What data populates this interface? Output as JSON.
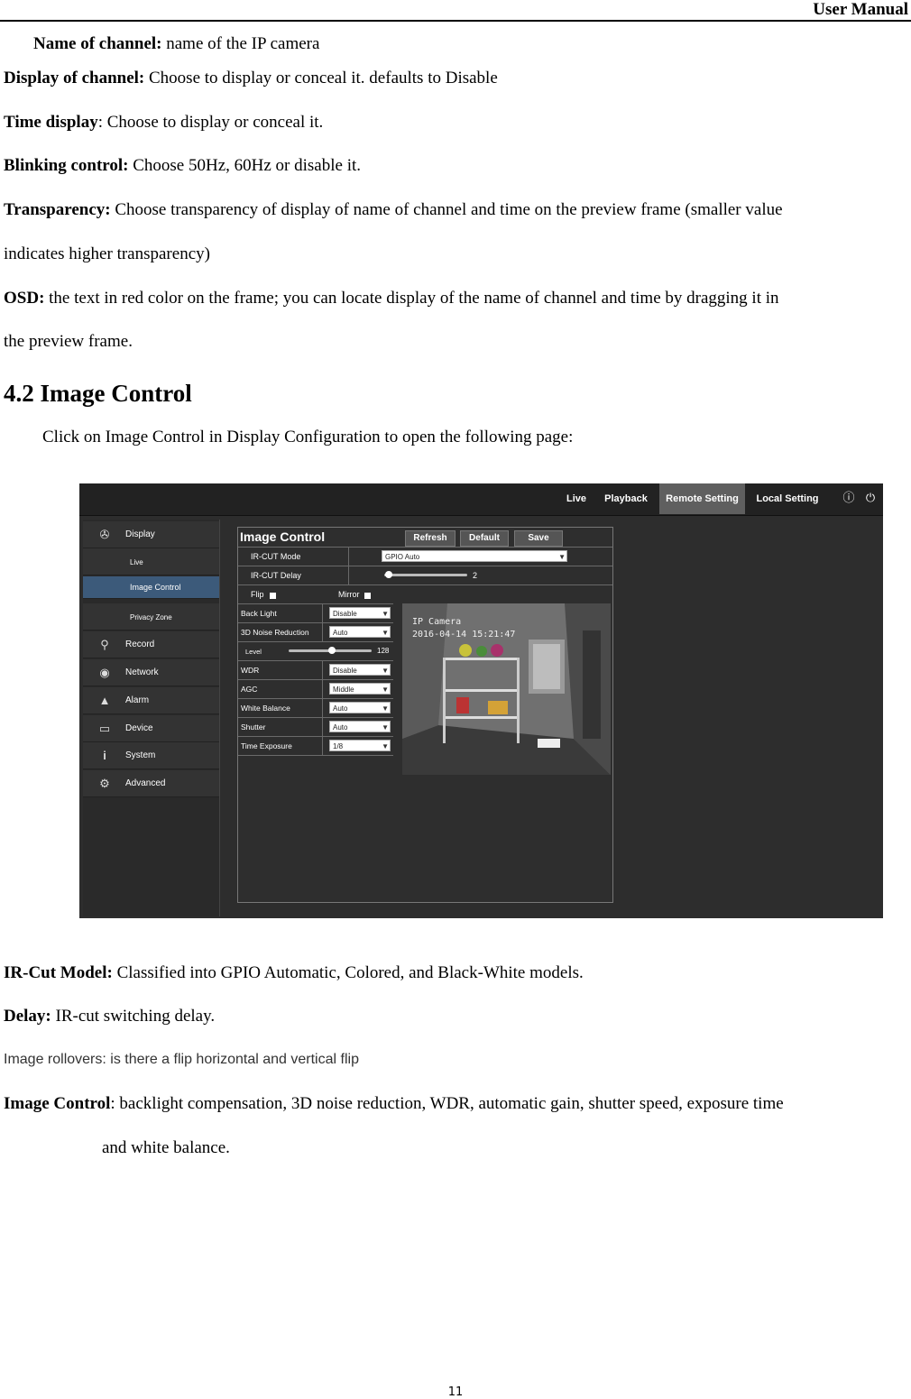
{
  "header": {
    "title": "User Manual"
  },
  "paragraphs": {
    "name_of_channel": {
      "term": "Name of channel:",
      "text": " name of the IP camera"
    },
    "display_of_channel": {
      "term": "Display of channel:",
      "text": " Choose to display or conceal it. defaults to Disable"
    },
    "time_display": {
      "term": "Time display",
      "text": ": Choose to display or conceal it."
    },
    "blinking_control": {
      "term": "Blinking control:",
      "text": " Choose 50Hz, 60Hz or disable it."
    },
    "transparency": {
      "term": "Transparency:",
      "text": " Choose transparency of display of name of channel and time on the preview frame (smaller value",
      "cont": "indicates higher transparency)"
    },
    "osd": {
      "term": "OSD:",
      "text": " the text in red color on the frame; you can locate display of the name of channel and time by dragging it in",
      "cont": "the preview frame."
    }
  },
  "section": {
    "heading": "4.2 Image Control",
    "intro": "Click on Image Control in Display Configuration to open the following page:"
  },
  "screenshot": {
    "topnav": [
      "Live",
      "Playback",
      "Remote Setting",
      "Local Setting"
    ],
    "topnav_active": "Remote Setting",
    "top_icons": [
      "info-icon",
      "power-icon"
    ],
    "sidebar": {
      "display": "Display",
      "live": "Live",
      "image_control": "Image Control",
      "privacy_zone": "Privacy Zone",
      "record": "Record",
      "network": "Network",
      "alarm": "Alarm",
      "device": "Device",
      "system": "System",
      "advanced": "Advanced"
    },
    "panel": {
      "title": "Image Control",
      "refresh": "Refresh",
      "default": "Default",
      "save": "Save",
      "ircut_mode_label": "IR-CUT Mode",
      "ircut_mode_value": "GPIO Auto",
      "ircut_delay_label": "IR-CUT Delay",
      "ircut_delay_value": "2",
      "flip_label": "Flip",
      "mirror_label": "Mirror",
      "back_light_label": "Back Light",
      "back_light_value": "Disable",
      "noise_label": "3D Noise Reduction",
      "noise_value": "Auto",
      "level_label": "Level",
      "level_value": "128",
      "wdr_label": "WDR",
      "wdr_value": "Disable",
      "agc_label": "AGC",
      "agc_value": "Middle",
      "white_balance_label": "White Balance",
      "white_balance_value": "Auto",
      "shutter_label": "Shutter",
      "shutter_value": "Auto",
      "time_exposure_label": "Time Exposure",
      "time_exposure_value": "1/8",
      "camera_osd": "IP Camera\n2016-04-14 15:21:47"
    }
  },
  "after": {
    "ircut_model": {
      "term": "IR-Cut Model:",
      "text": " Classified into GPIO Automatic, Colored, and Black-White models."
    },
    "delay": {
      "term": "Delay:",
      "text": " IR-cut switching delay."
    },
    "rollovers": "Image rollovers: is there a flip horizontal and vertical flip",
    "image_control": {
      "term": "Image Control",
      "text": ": backlight compensation, 3D noise reduction, WDR, automatic gain, shutter speed, exposure time",
      "cont": "and white balance."
    }
  },
  "page_number": "11"
}
